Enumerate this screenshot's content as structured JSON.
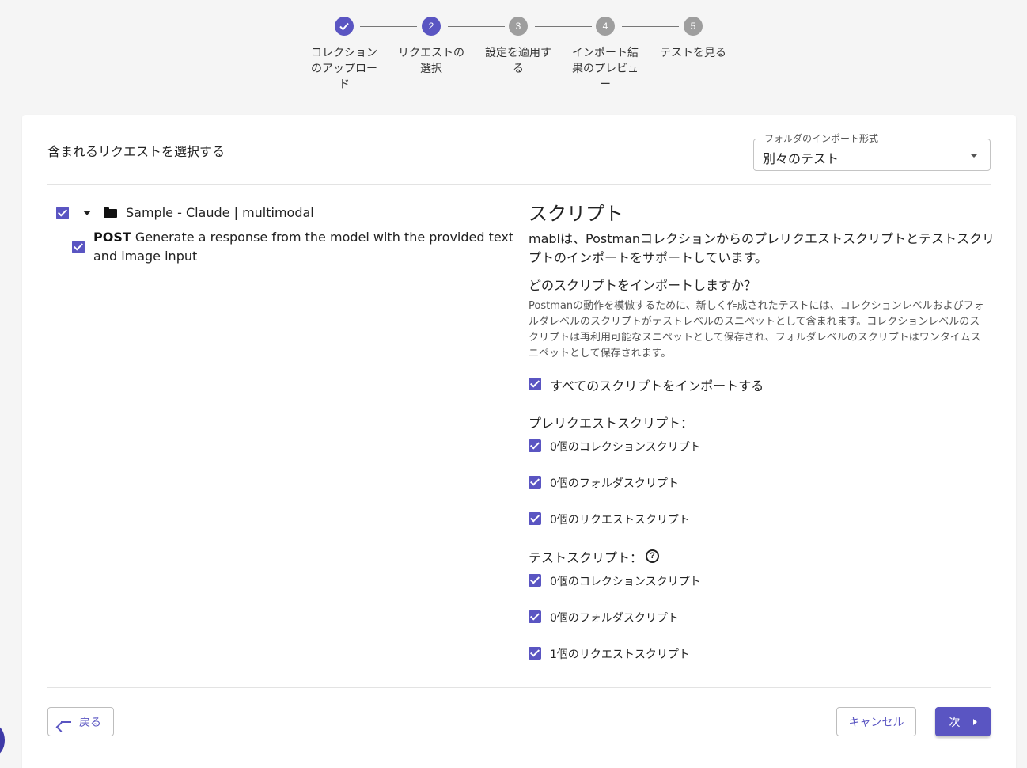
{
  "stepper": {
    "steps": [
      {
        "number": "",
        "label": "コレクションのアップロード",
        "state": "completed"
      },
      {
        "number": "2",
        "label": "リクエストの選択",
        "state": "active"
      },
      {
        "number": "3",
        "label": "設定を適用する",
        "state": "todo"
      },
      {
        "number": "4",
        "label": "インポート結果のプレビュー",
        "state": "todo"
      },
      {
        "number": "5",
        "label": "テストを見る",
        "state": "todo"
      }
    ]
  },
  "main": {
    "title": "含まれるリクエストを選択する",
    "import_format": {
      "label": "フォルダのインポート形式",
      "value": "別々のテスト"
    }
  },
  "tree": {
    "collection_name": "Sample - Claude | multimodal",
    "request_method": "POST",
    "request_name": "Generate a response from the model with the provided text and image input"
  },
  "scripts": {
    "title": "スクリプト",
    "description": "mablは、Postmanコレクションからのプレリクエストスクリプトとテストスクリプトのインポートをサポートしています。",
    "question": "どのスクリプトをインポートしますか？",
    "note": "Postmanの動作を模倣するために、新しく作成されたテストには、コレクションレベルおよびフォルダレベルのスクリプトがテストレベルのスニペットとして含まれます。コレクションレベルのスクリプトは再利用可能なスニペットとして保存され、フォルダレベルのスクリプトはワンタイムスニペットとして保存されます。",
    "import_all_label": "すべてのスクリプトをインポートする",
    "pre_request": {
      "title": "プレリクエストスクリプト：",
      "options": [
        "0個のコレクションスクリプト",
        "0個のフォルダスクリプト",
        "0個のリクエストスクリプト"
      ]
    },
    "test": {
      "title": "テストスクリプト：",
      "options": [
        "0個のコレクションスクリプト",
        "0個のフォルダスクリプト",
        "1個のリクエストスクリプト"
      ]
    }
  },
  "footer": {
    "back_label": "戻る",
    "cancel_label": "キャンセル",
    "next_label": "次"
  },
  "colors": {
    "accent": "#5a55c2",
    "inactive_step": "#9e9e9e"
  }
}
